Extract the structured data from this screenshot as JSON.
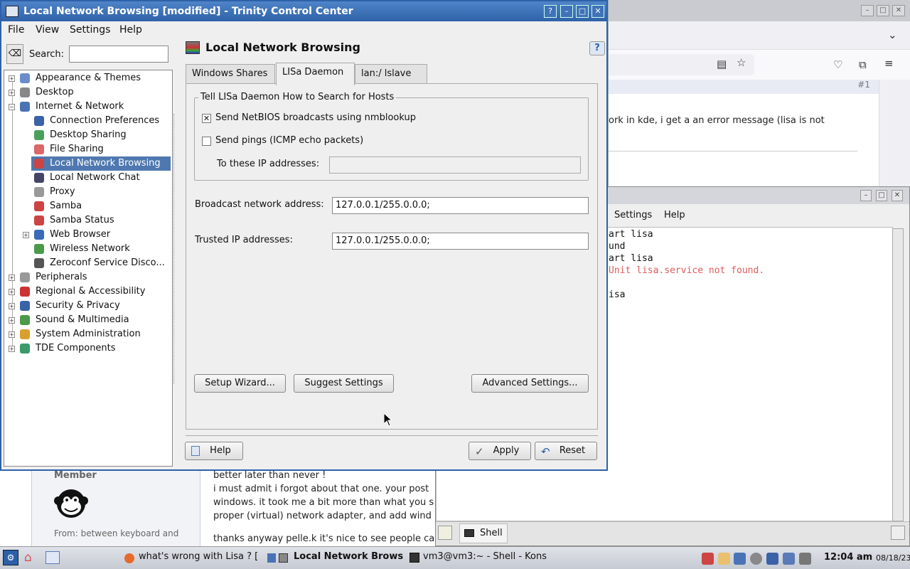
{
  "browser": {
    "hash": "#1",
    "post_text": "ork in kde, i get a an error message (lisa is not"
  },
  "forum": {
    "member_label": "Member",
    "from_label": "From: between keyboard and",
    "lines": [
      "better later than never !",
      "i must admit i forgot about that one. your post",
      "windows. it took me a bit more than what you s",
      "proper (virtual) network adapter, and add wind",
      "thanks anyway pelle.k it's nice to see people ca"
    ]
  },
  "konsole": {
    "menu": [
      "Settings",
      "Help"
    ],
    "lines": [
      "art lisa",
      "und",
      "art lisa",
      "Unit lisa.service not found.",
      "",
      "isa"
    ],
    "error_color": "#e05a5a",
    "tab_label": "Shell"
  },
  "tcc": {
    "window_title": "Local Network Browsing [modified] - Trinity Control Center",
    "title_buttons": [
      "?",
      "–",
      "□",
      "✕"
    ],
    "menu": [
      "File",
      "View",
      "Settings",
      "Help"
    ],
    "search_label": "Search:",
    "search_value": "",
    "tree": [
      {
        "label": "Appearance & Themes",
        "level": 0,
        "expander": "+",
        "color": "#6b8cc8"
      },
      {
        "label": "Desktop",
        "level": 0,
        "expander": "+",
        "color": "#888"
      },
      {
        "label": "Internet & Network",
        "level": 0,
        "expander": "−",
        "color": "#4a73b5"
      },
      {
        "label": "Connection Preferences",
        "level": 1,
        "expander": "",
        "color": "#3a62a8"
      },
      {
        "label": "Desktop Sharing",
        "level": 1,
        "expander": "",
        "color": "#4aa05a"
      },
      {
        "label": "File Sharing",
        "level": 1,
        "expander": "",
        "color": "#d66"
      },
      {
        "label": "Local Network Browsing",
        "level": 1,
        "expander": "",
        "color": "#c44",
        "selected": true
      },
      {
        "label": "Local Network Chat",
        "level": 1,
        "expander": "",
        "color": "#446"
      },
      {
        "label": "Proxy",
        "level": 1,
        "expander": "",
        "color": "#999"
      },
      {
        "label": "Samba",
        "level": 1,
        "expander": "",
        "color": "#c44"
      },
      {
        "label": "Samba Status",
        "level": 1,
        "expander": "",
        "color": "#c44"
      },
      {
        "label": "Web Browser",
        "level": 1,
        "expander": "+",
        "color": "#3a6bb8"
      },
      {
        "label": "Wireless Network",
        "level": 1,
        "expander": "",
        "color": "#4a9a4a"
      },
      {
        "label": "Zeroconf Service Disco...",
        "level": 1,
        "expander": "",
        "color": "#555"
      },
      {
        "label": "Peripherals",
        "level": 0,
        "expander": "+",
        "color": "#999"
      },
      {
        "label": "Regional & Accessibility",
        "level": 0,
        "expander": "+",
        "color": "#c33"
      },
      {
        "label": "Security & Privacy",
        "level": 0,
        "expander": "+",
        "color": "#3a62a8"
      },
      {
        "label": "Sound & Multimedia",
        "level": 0,
        "expander": "+",
        "color": "#4a9a4a"
      },
      {
        "label": "System Administration",
        "level": 0,
        "expander": "+",
        "color": "#d9a030"
      },
      {
        "label": "TDE Components",
        "level": 0,
        "expander": "+",
        "color": "#3a9a6a"
      }
    ],
    "pane_title": "Local Network Browsing",
    "tabs": [
      "Windows Shares",
      "LISa Daemon",
      "lan:/ lslave"
    ],
    "active_tab": 1,
    "group_title": "Tell LISa Daemon How to Search for Hosts",
    "nmblookup": {
      "label": "Send NetBIOS broadcasts using nmblookup",
      "checked": true
    },
    "pings": {
      "label": "Send pings (ICMP echo packets)",
      "checked": false
    },
    "ip_label": "To these IP addresses:",
    "ip_value": "",
    "broadcast_label": "Broadcast network address:",
    "broadcast_value": "127.0.0.1/255.0.0.0;",
    "trusted_label": "Trusted IP addresses:",
    "trusted_value": "127.0.0.1/255.0.0.0;",
    "buttons": {
      "setup": "Setup Wizard...",
      "suggest": "Suggest Settings",
      "advanced": "Advanced Settings...",
      "help": "Help",
      "apply": "Apply",
      "reset": "Reset"
    }
  },
  "taskbar": {
    "items": [
      "what's wrong with Lisa ? [",
      "Local Network Brows",
      "vm3@vm3:~ - Shell - Kons"
    ],
    "clock": "12:04 am",
    "date": "08/18/23"
  }
}
